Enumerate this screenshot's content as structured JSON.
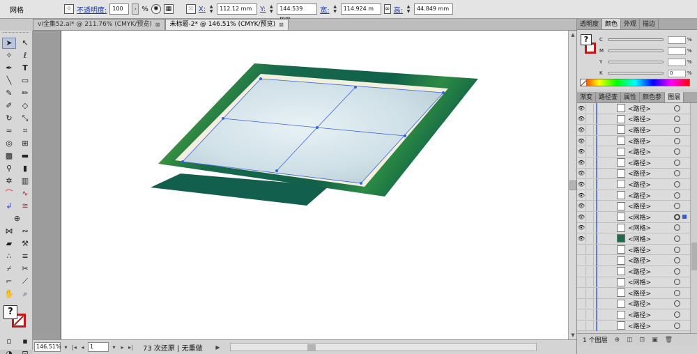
{
  "control_bar": {
    "selection_type": "网格",
    "opacity_label": "不透明度:",
    "opacity_value": "100",
    "opacity_unit": "%",
    "x_label": "X:",
    "x_value": "112.12 mm",
    "y_label": "Y:",
    "y_value": "144.539 mm",
    "width_label": "宽:",
    "width_value": "114.924 m",
    "height_label": "高:",
    "height_value": "44.849 mm"
  },
  "tabs": [
    {
      "label": "vi全集52.ai* @ 211.76% (CMYK/预览)",
      "close": "⊠"
    },
    {
      "label": "未标题-2* @ 146.51% (CMYK/预览)",
      "close": "⊠"
    }
  ],
  "status_bar": {
    "zoom": "146.51%",
    "artboard": "1",
    "status_text": "73 次还原 | 无重做"
  },
  "color_panel": {
    "tabs": [
      "透明度",
      "颜色",
      "外观",
      "描边"
    ],
    "channels": [
      {
        "name": "C",
        "value": ""
      },
      {
        "name": "M",
        "value": ""
      },
      {
        "name": "Y",
        "value": ""
      },
      {
        "name": "K",
        "value": "0"
      }
    ],
    "unit": "%"
  },
  "layers_panel": {
    "tabs": [
      "渐变",
      "路径查",
      "属性",
      "颜色参",
      "图层"
    ],
    "rows": [
      {
        "name": "<路径>",
        "visible": true,
        "thumb": "blank"
      },
      {
        "name": "<路径>",
        "visible": true,
        "thumb": "line"
      },
      {
        "name": "<路径>",
        "visible": true,
        "thumb": "blank"
      },
      {
        "name": "<路径>",
        "visible": true,
        "thumb": "line"
      },
      {
        "name": "<路径>",
        "visible": true,
        "thumb": "blank"
      },
      {
        "name": "<路径>",
        "visible": true,
        "thumb": "blank"
      },
      {
        "name": "<路径>",
        "visible": true,
        "thumb": "blank"
      },
      {
        "name": "<路径>",
        "visible": true,
        "thumb": "blank"
      },
      {
        "name": "<路径>",
        "visible": true,
        "thumb": "blank"
      },
      {
        "name": "<路径>",
        "visible": true,
        "thumb": "blank"
      },
      {
        "name": "<网格>",
        "visible": true,
        "thumb": "blank",
        "selected": true
      },
      {
        "name": "<网格>",
        "visible": true,
        "thumb": "blank"
      },
      {
        "name": "<网格>",
        "visible": true,
        "thumb": "green"
      },
      {
        "name": "<路径>",
        "visible": false,
        "thumb": "blank"
      },
      {
        "name": "<路径>",
        "visible": false,
        "thumb": "blank"
      },
      {
        "name": "<路径>",
        "visible": false,
        "thumb": "blank"
      },
      {
        "name": "<网格>",
        "visible": false,
        "thumb": "line"
      },
      {
        "name": "<路径>",
        "visible": false,
        "thumb": "blank"
      },
      {
        "name": "<路径>",
        "visible": false,
        "thumb": "blank"
      },
      {
        "name": "<路径>",
        "visible": false,
        "thumb": "blank"
      },
      {
        "name": "<路径>",
        "visible": false,
        "thumb": "blank"
      }
    ],
    "footer_count": "1 个图层"
  },
  "colors": {
    "frame_green": "#1a6b4f",
    "mesh_line": "#3a62e6",
    "screen_blue": "#c9dde6"
  }
}
